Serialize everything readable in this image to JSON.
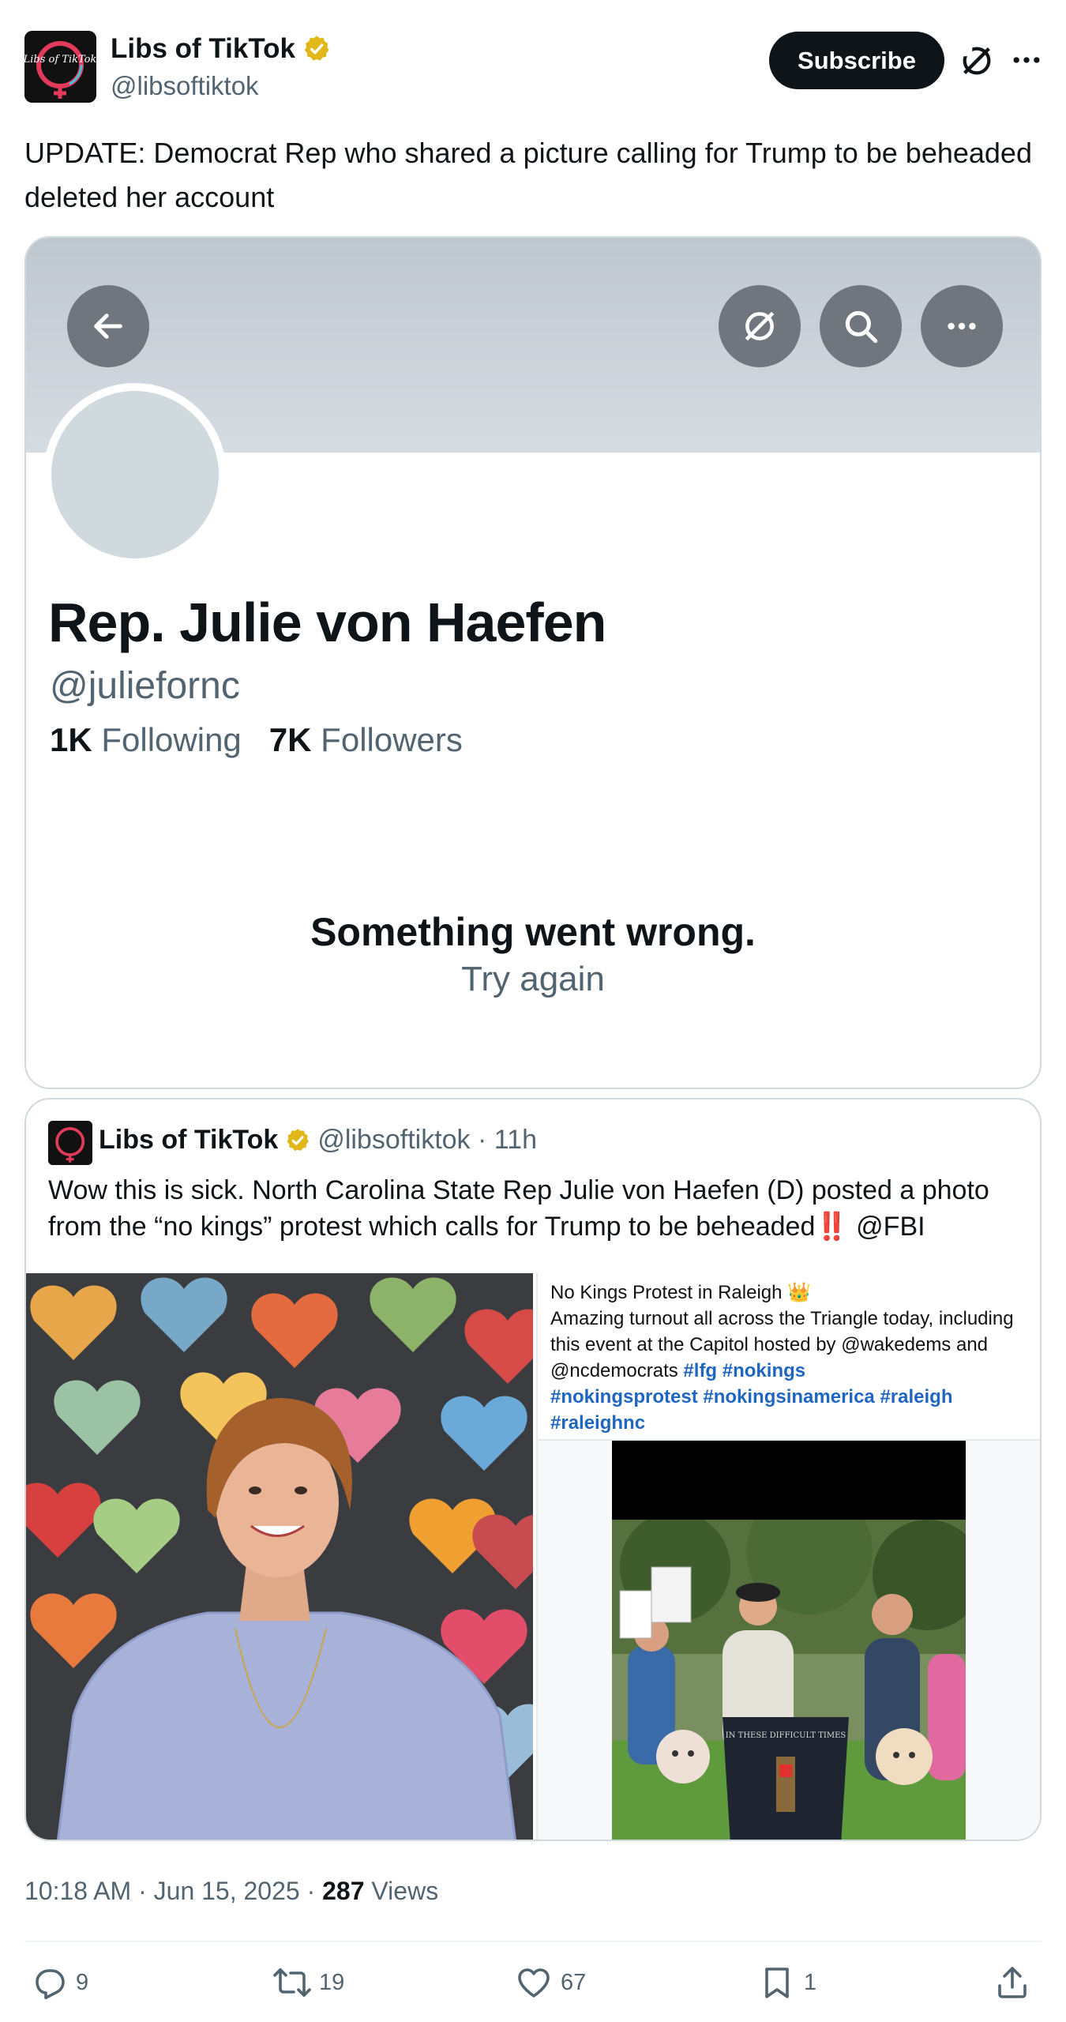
{
  "tweet": {
    "author_name": "Libs of TikTok",
    "author_handle": "@libsoftiktok",
    "subscribe_label": "Subscribe",
    "text": "UPDATE: Democrat Rep who shared a picture calling for Trump to be beheaded deleted her account",
    "timestamp": "10:18 AM · Jun 15, 2025 · ",
    "views_count": "287",
    "views_label": " Views"
  },
  "embedded_profile": {
    "name": "Rep. Julie von Haefen",
    "handle": "@juliefornc",
    "following_count": "1K",
    "following_label": " Following",
    "followers_count": "7K",
    "followers_label": " Followers",
    "error_title": "Something went wrong.",
    "error_retry": "Try again"
  },
  "quote": {
    "author_name": "Libs of TikTok",
    "meta": "@libsoftiktok · 11h",
    "text": "Wow this is sick. North Carolina State Rep Julie von Haefen (D) posted a photo from the “no kings” protest which calls for Trump to be beheaded‼️ @FBI",
    "caption_line1": "No Kings Protest in Raleigh 👑",
    "caption_line2": "Amazing turnout all across the Triangle today, including this event at the Capitol hosted by @wakedems and @ncdemocrats ",
    "caption_tags_inline": "#lfg #nokings",
    "caption_tags": "#nokingsprotest #nokingsinamerica #raleigh #raleighnc",
    "sign_text": "IN THESE DIFFICULT TIMES",
    "logo_text": "Libs of TikTok"
  },
  "actions": {
    "replies": "9",
    "retweets": "19",
    "likes": "67",
    "bookmarks": "1"
  },
  "colors": {
    "text_primary": "#0f1419",
    "text_secondary": "#536471",
    "verified_gold": "#e2b719",
    "link_blue": "#1f66c1",
    "border": "#cfd9de"
  },
  "icons": [
    "verified-badge-icon",
    "grok-icon",
    "more-icon",
    "back-arrow-icon",
    "search-icon",
    "reply-icon",
    "retweet-icon",
    "like-icon",
    "bookmark-icon",
    "share-icon"
  ]
}
